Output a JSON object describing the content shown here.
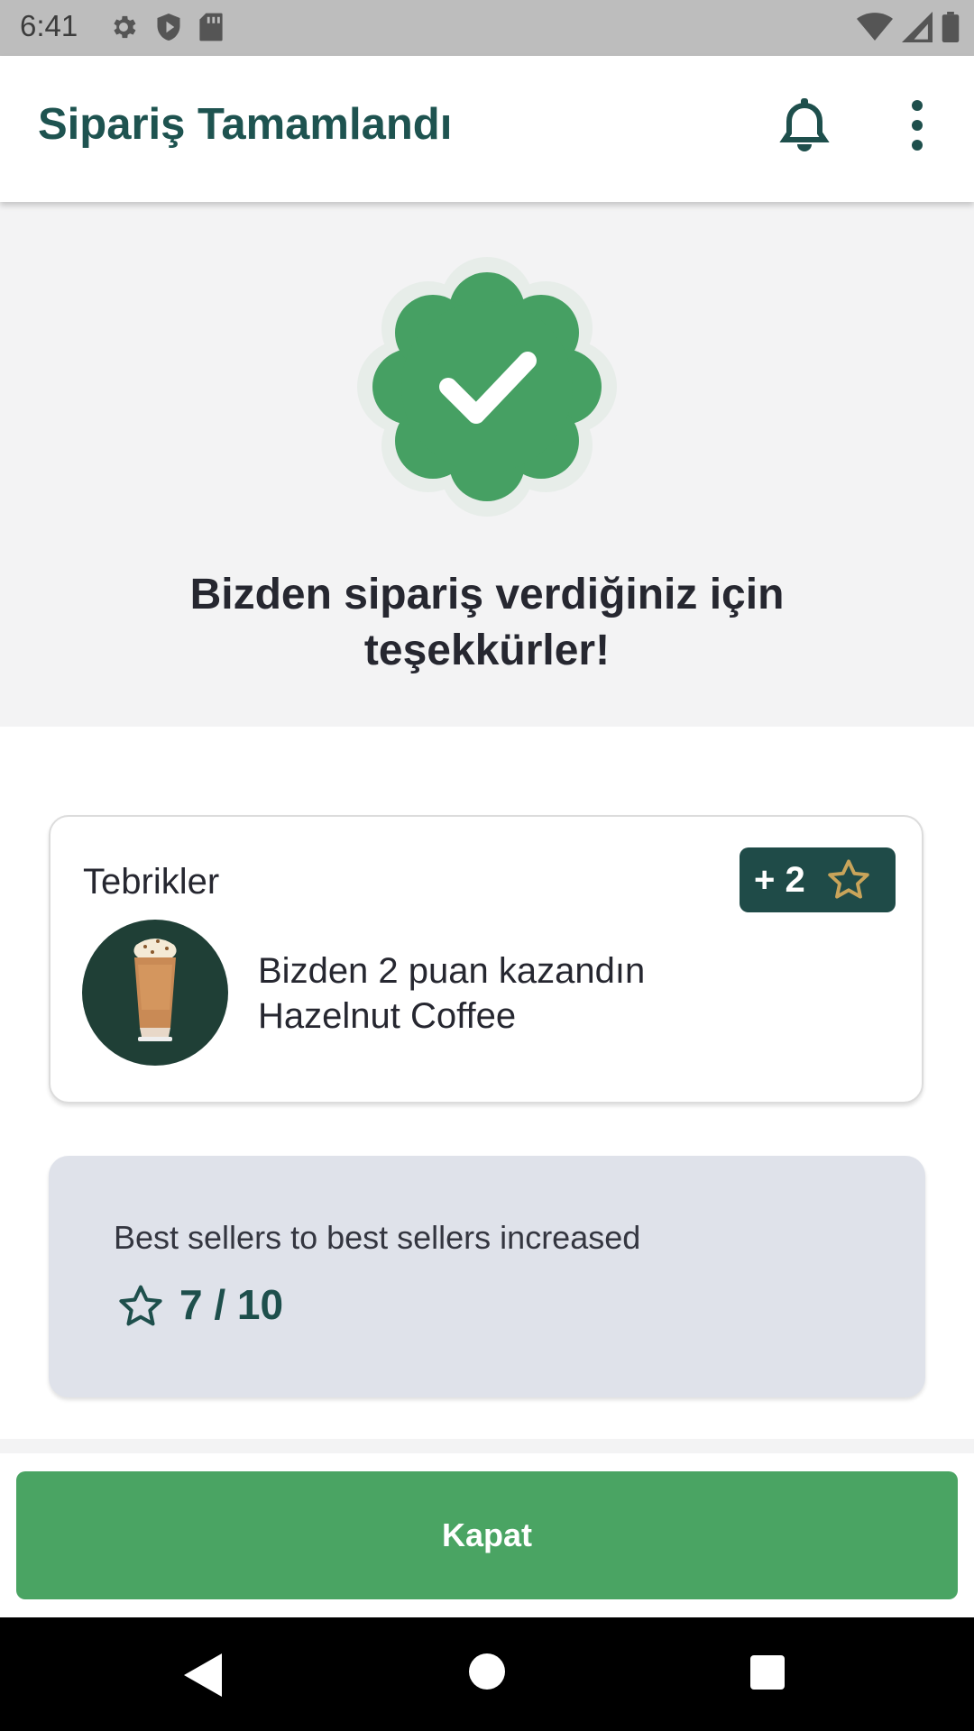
{
  "status_bar": {
    "time": "6:41",
    "left_icons": [
      "settings-icon",
      "shield-icon",
      "sd-card-icon"
    ],
    "right_icons": [
      "wifi-icon",
      "signal-icon",
      "battery-icon"
    ]
  },
  "app_bar": {
    "title": "Sipariş Tamamlandı",
    "actions": [
      "bell-icon",
      "more-vertical-icon"
    ],
    "title_color": "#1e5350"
  },
  "confirmation": {
    "icon": "check-badge-icon",
    "message": "Bizden sipariş verdiğiniz için teşekkürler!",
    "badge_color": "#46a063"
  },
  "reward_card": {
    "title": "Tebrikler",
    "points_badge": "+ 2",
    "points_icon": "star-outline-icon",
    "product_image": "hazelnut-coffee-image",
    "line1": "Bizden 2 puan kazandın",
    "line2": "Hazelnut Coffee",
    "badge_color": "#1f4b48",
    "star_color": "#c9a45a"
  },
  "progress_card": {
    "label": "Best sellers to best sellers increased",
    "icon": "star-outline-icon",
    "current": 7,
    "total": 10,
    "value_text": "7 / 10",
    "background": "#dfe2ea"
  },
  "close_button": {
    "label": "Kapat",
    "color": "#4aa463"
  },
  "nav_bar": {
    "buttons": [
      "back-icon",
      "home-icon",
      "recent-apps-icon"
    ]
  }
}
